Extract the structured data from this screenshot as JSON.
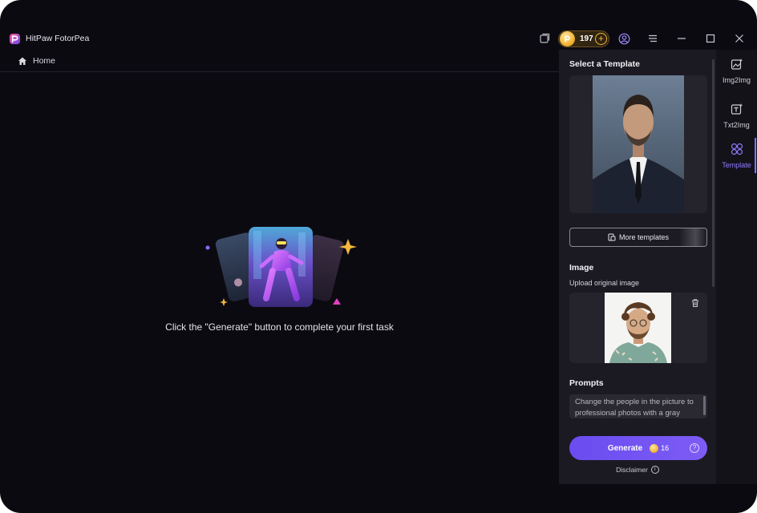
{
  "app": {
    "title": "HitPaw FotorPea",
    "logo_icon": "hitpaw-fotorpea-logo"
  },
  "titlebar": {
    "credits_count": "197",
    "icons": [
      "library-icon",
      "coin-icon",
      "add-credits-icon",
      "account-icon",
      "menu-icon",
      "minimize-icon",
      "maximize-icon",
      "close-icon"
    ]
  },
  "breadcrumb": {
    "home_label": "Home"
  },
  "main": {
    "empty_message": "Click the \"Generate\" button to complete your first task"
  },
  "panel": {
    "select_template_title": "Select a Template",
    "more_templates_label": "More templates",
    "image_title": "Image",
    "upload_label": "Upload original image",
    "prompts_title": "Prompts",
    "prompt_text": "Change the people in the picture to professional photos with a gray background",
    "generate_label": "Generate",
    "generate_cost": "16",
    "disclaimer_label": "Disclaimer"
  },
  "rail": {
    "items": [
      {
        "label": "Img2Img",
        "icon": "image-edit-icon",
        "active": false
      },
      {
        "label": "Txt2Img",
        "icon": "text-to-image-icon",
        "active": false
      },
      {
        "label": "Template",
        "icon": "template-grid-icon",
        "active": true
      }
    ]
  },
  "colors": {
    "accent": "#7d5cf5",
    "background": "#0c0a11",
    "panel": "#1b1a22",
    "coin": "#f5b83a"
  }
}
